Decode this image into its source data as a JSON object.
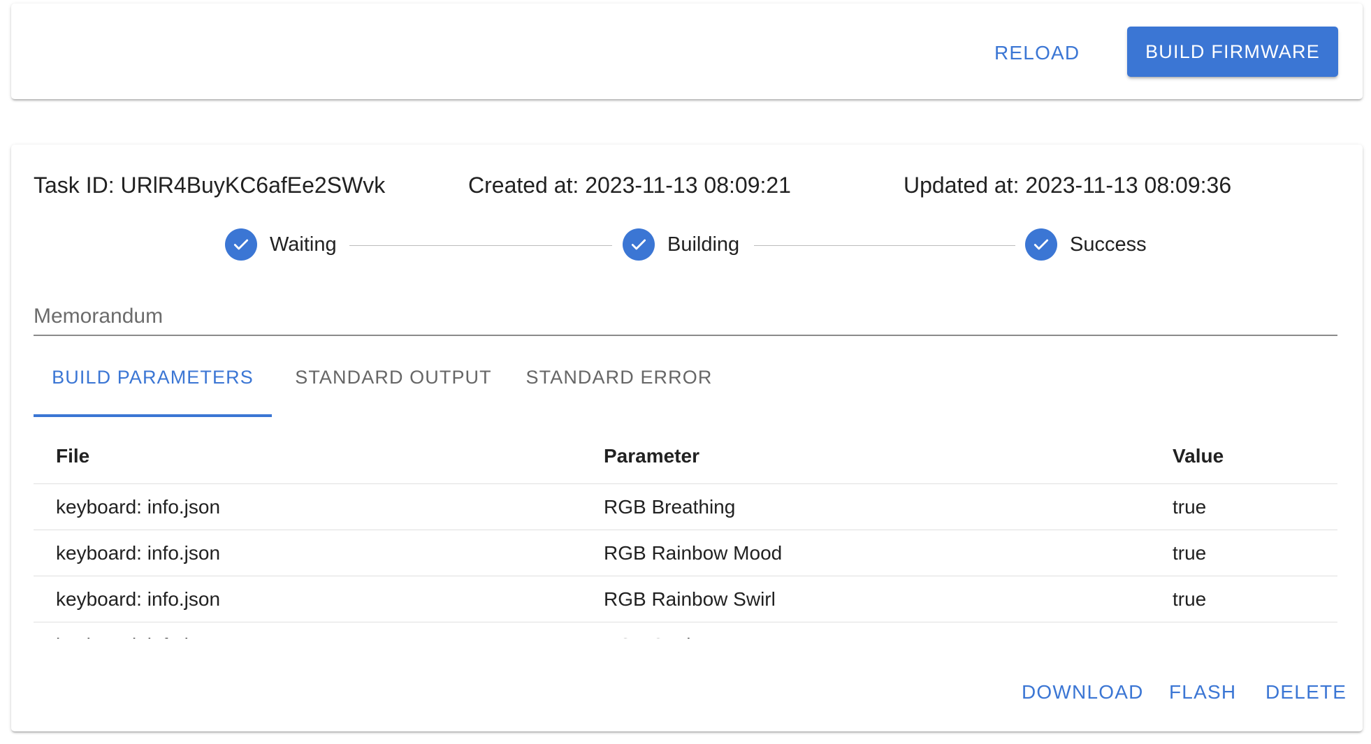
{
  "toolbar": {
    "reload_label": "RELOAD",
    "build_label": "BUILD FIRMWARE"
  },
  "task": {
    "task_id": "Task ID: URlR4BuyKC6afEe2SWvk",
    "created_at": "Created at: 2023-11-13 08:09:21",
    "updated_at": "Updated at: 2023-11-13 08:09:36"
  },
  "steps": [
    {
      "label": "Waiting",
      "icon": "check-icon",
      "done": true
    },
    {
      "label": "Building",
      "icon": "check-icon",
      "done": true
    },
    {
      "label": "Success",
      "icon": "check-icon",
      "done": true
    }
  ],
  "memo": {
    "placeholder": "Memorandum",
    "value": ""
  },
  "tabs": [
    {
      "label": "BUILD PARAMETERS",
      "active": true
    },
    {
      "label": "STANDARD OUTPUT",
      "active": false
    },
    {
      "label": "STANDARD ERROR",
      "active": false
    }
  ],
  "table": {
    "headers": [
      "File",
      "Parameter",
      "Value"
    ],
    "rows": [
      [
        "keyboard: info.json",
        "RGB Breathing",
        "true"
      ],
      [
        "keyboard: info.json",
        "RGB Rainbow Mood",
        "true"
      ],
      [
        "keyboard: info.json",
        "RGB Rainbow Swirl",
        "true"
      ],
      [
        "keyboard: info.json",
        "RGB Snake",
        "true"
      ]
    ]
  },
  "actions": {
    "download_label": "DOWNLOAD",
    "flash_label": "FLASH",
    "delete_label": "DELETE"
  },
  "colors": {
    "accent": "#3b76d4",
    "divider": "#e0e0e0"
  }
}
